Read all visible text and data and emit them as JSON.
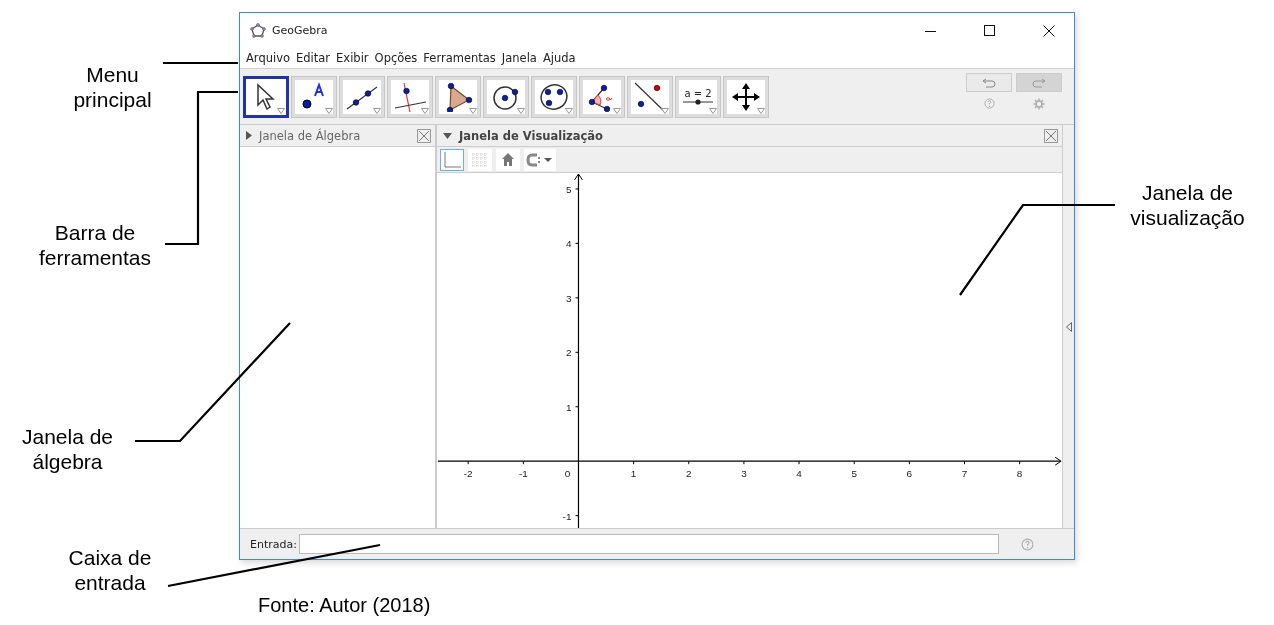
{
  "window": {
    "title": "GeoGebra"
  },
  "menu": [
    "Arquivo",
    "Editar",
    "Exibir",
    "Opções",
    "Ferramentas",
    "Janela",
    "Ajuda"
  ],
  "tools": [
    {
      "kind": "move",
      "selected": true
    },
    {
      "kind": "point",
      "selected": false
    },
    {
      "kind": "line",
      "selected": false
    },
    {
      "kind": "perpendicular",
      "selected": false
    },
    {
      "kind": "polygon",
      "selected": false
    },
    {
      "kind": "circle",
      "selected": false
    },
    {
      "kind": "conic",
      "selected": false
    },
    {
      "kind": "angle",
      "selected": false
    },
    {
      "kind": "reflect",
      "selected": false
    },
    {
      "kind": "slider",
      "selected": false,
      "label": "a = 2"
    },
    {
      "kind": "pan",
      "selected": false
    }
  ],
  "algebra_view": {
    "title": "Janela de Álgebra",
    "style_bar_open": false
  },
  "graphics_view": {
    "title": "Janela de Visualização",
    "style_bar_open": true,
    "axes_on": true,
    "grid_on": false,
    "x_ticks": [
      "-2",
      "-1",
      "0",
      "1",
      "2",
      "3",
      "4",
      "5",
      "6",
      "7",
      "8"
    ],
    "y_ticks": [
      "5",
      "4",
      "3",
      "2",
      "1",
      "-1"
    ]
  },
  "input_bar": {
    "label": "Entrada:"
  },
  "annotations": [
    "Menu principal",
    "Barra de ferramentas",
    "Janela de álgebra",
    "Caixa de entrada",
    "Janela de visualização"
  ],
  "caption": "Fonte: Autor (2018)"
}
